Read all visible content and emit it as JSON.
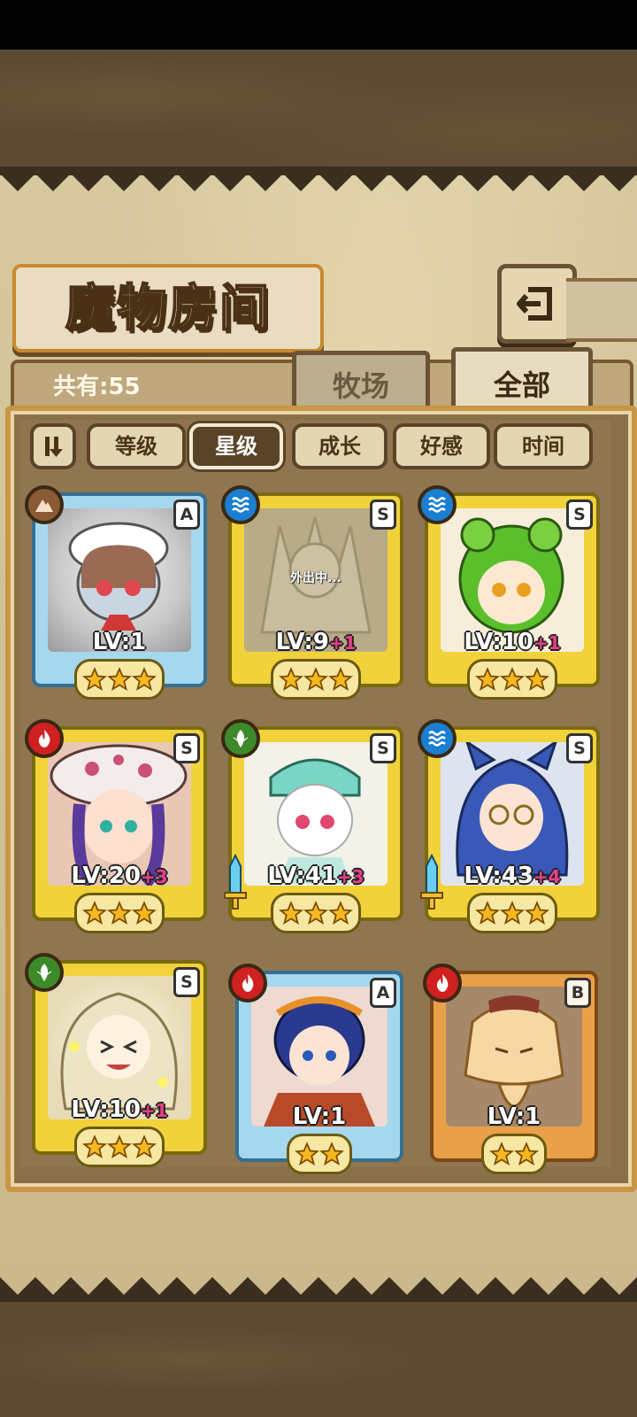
{
  "title": "魔物房间",
  "monster_count": "共有:55",
  "tabs": {
    "farm": "牧场",
    "all": "全部"
  },
  "sort_buttons": [
    "等级",
    "星级",
    "成长",
    "好感",
    "时间"
  ],
  "cards": [
    {
      "grade": "A",
      "element": "earth",
      "level": "LV:1",
      "level_bonus": "",
      "stars": 3,
      "frame": "blue"
    },
    {
      "grade": "S",
      "element": "water",
      "level": "LV:9",
      "level_bonus": "+1",
      "stars": 3,
      "frame": "yellow",
      "status": "外出中..."
    },
    {
      "grade": "S",
      "element": "water",
      "level": "LV:10",
      "level_bonus": "+1",
      "stars": 3,
      "frame": "yellow"
    },
    {
      "grade": "S",
      "element": "fire",
      "level": "LV:20",
      "level_bonus": "+3",
      "stars": 3,
      "frame": "yellow"
    },
    {
      "grade": "S",
      "element": "grass",
      "level": "LV:41",
      "level_bonus": "+3",
      "stars": 3,
      "frame": "yellow",
      "equipped": true
    },
    {
      "grade": "S",
      "element": "water",
      "level": "LV:43",
      "level_bonus": "+4",
      "stars": 3,
      "frame": "yellow",
      "equipped": true
    },
    {
      "grade": "S",
      "element": "grass",
      "level": "LV:10",
      "level_bonus": "+1",
      "stars": 3,
      "frame": "yellow"
    },
    {
      "grade": "A",
      "element": "fire",
      "level": "LV:1",
      "level_bonus": "",
      "stars": 2,
      "frame": "blue"
    },
    {
      "grade": "B",
      "element": "fire",
      "level": "LV:1",
      "level_bonus": "",
      "stars": 2,
      "frame": "orange"
    }
  ],
  "colors": {
    "star": "#f5b820",
    "level_bonus": "#e8408a",
    "frame_yellow": "#f1d23a",
    "frame_blue": "#a5d8ef",
    "frame_orange": "#e9a048"
  }
}
